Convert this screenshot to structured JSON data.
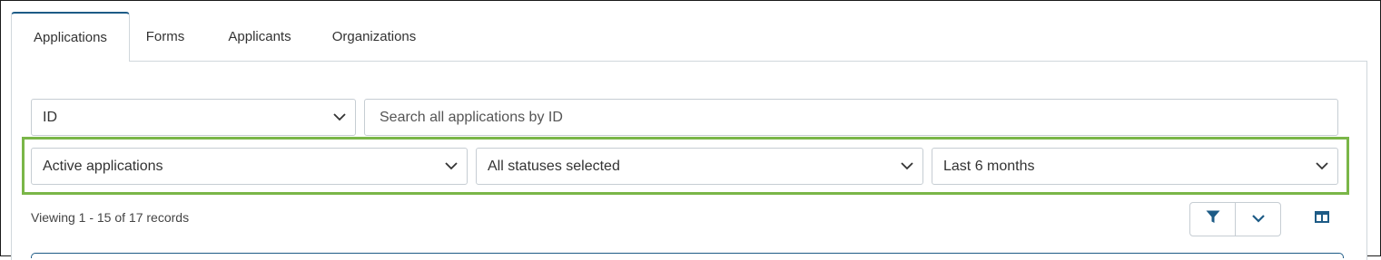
{
  "tabs": [
    {
      "label": "Applications",
      "active": true
    },
    {
      "label": "Forms",
      "active": false
    },
    {
      "label": "Applicants",
      "active": false
    },
    {
      "label": "Organizations",
      "active": false
    }
  ],
  "search": {
    "field_select_value": "ID",
    "placeholder": "Search all applications by ID",
    "value": ""
  },
  "filters": {
    "applications": "Active applications",
    "statuses": "All statuses selected",
    "date_range": "Last 6 months"
  },
  "records_text": "Viewing 1 - 15 of 17 records",
  "colors": {
    "accent": "#1d5b86",
    "highlight": "#7ab648",
    "border": "#c6cdd3"
  },
  "icons": {
    "filter": "filter-icon",
    "chevron": "chevron-down-icon",
    "columns": "columns-icon"
  }
}
